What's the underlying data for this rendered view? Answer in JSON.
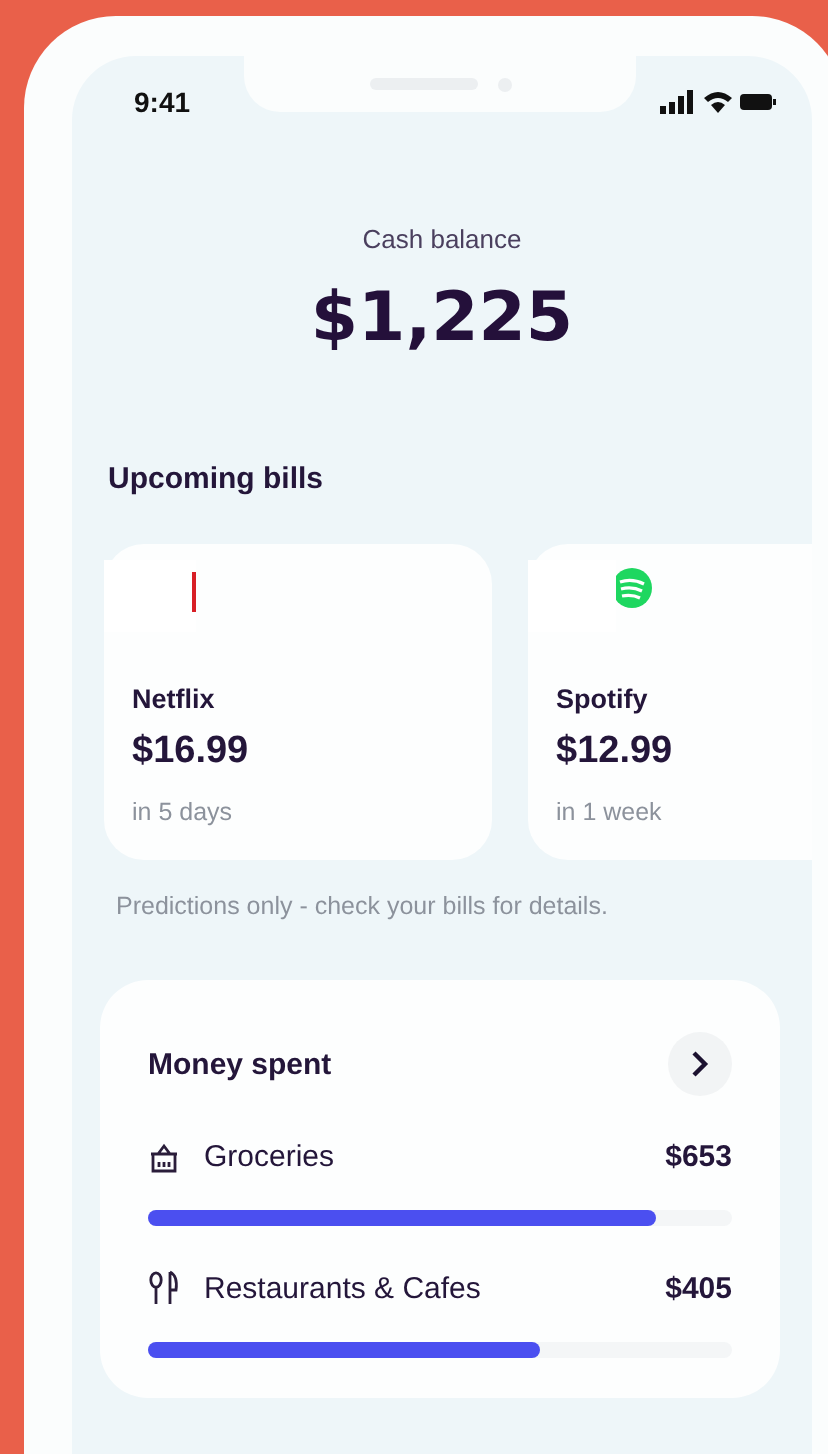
{
  "status_bar": {
    "time": "9:41"
  },
  "balance": {
    "label": "Cash balance",
    "amount": "$1,225"
  },
  "upcoming_bills": {
    "title": "Upcoming bills",
    "bills": [
      {
        "kind": "netflix",
        "name": "Netflix",
        "amount": "$16.99",
        "due": "in 5 days"
      },
      {
        "kind": "spotify",
        "name": "Spotify",
        "amount": "$12.99",
        "due": "in 1 week"
      }
    ],
    "note": "Predictions only - check your bills for details."
  },
  "money_spent": {
    "title": "Money spent",
    "categories": [
      {
        "kind": "groceries",
        "name": "Groceries",
        "amount": "$653",
        "level": 0.87
      },
      {
        "kind": "restaurants",
        "name": "Restaurants & Cafes",
        "amount": "$405",
        "level": 0.67
      }
    ]
  }
}
